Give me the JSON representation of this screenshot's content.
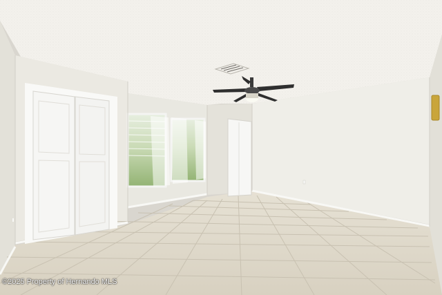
{
  "photo": {
    "watermark": "©2025 Property of Hernando MLS"
  },
  "scene_elements": {
    "ceiling_fan": "ceiling-fan",
    "air_vent": "hvac-vent",
    "thermostat": "thermostat"
  },
  "colors": {
    "ceiling": "#f3f1ec",
    "wall": "#ecebe4",
    "wall_shade": "#e2e0d8",
    "floor_tile": "#dcd6c8",
    "grout": "#c9c2b2",
    "door": "#f7f7f5",
    "window_green": "#7fa35a",
    "thermostat": "#c9a53a"
  }
}
